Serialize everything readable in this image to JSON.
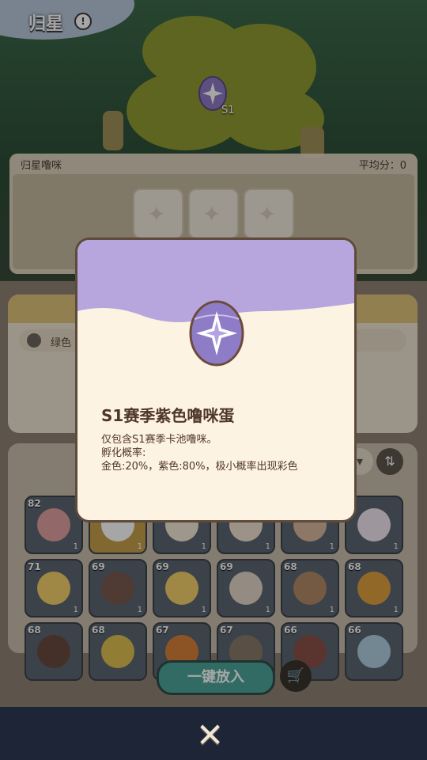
{
  "header": {
    "title": "归星"
  },
  "tree": {
    "egg_label": "S1"
  },
  "panel": {
    "name": "归星噜咪",
    "avg_score": "平均分：0"
  },
  "filter": {
    "label": "绿色"
  },
  "cards": [
    {
      "level": "82",
      "count": "1"
    },
    {
      "level": "",
      "count": "1"
    },
    {
      "level": "",
      "count": "1"
    },
    {
      "level": "",
      "count": "1"
    },
    {
      "level": "",
      "count": "1"
    },
    {
      "level": "2",
      "count": "1"
    },
    {
      "level": "71",
      "count": "1"
    },
    {
      "level": "69",
      "count": "1"
    },
    {
      "level": "69",
      "count": "1"
    },
    {
      "level": "69",
      "count": "1"
    },
    {
      "level": "68",
      "count": "1"
    },
    {
      "level": "68",
      "count": "1"
    },
    {
      "level": "68",
      "count": ""
    },
    {
      "level": "68",
      "count": ""
    },
    {
      "level": "67",
      "count": ""
    },
    {
      "level": "67",
      "count": ""
    },
    {
      "level": "66",
      "count": ""
    },
    {
      "level": "66",
      "count": ""
    }
  ],
  "actions": {
    "put_all": "一键放入"
  },
  "popup": {
    "title": "S1赛季紫色噜咪蛋",
    "line1": "仅包含S1赛季卡池噜咪。",
    "line2": "孵化概率:",
    "line3": "金色:20%，紫色:80%，极小概率出现彩色"
  },
  "colors": {
    "egg_purple": "#8f7cc7",
    "popup_bg": "#fdf3e2",
    "wave": "#b6a6dd",
    "button_teal": "#4ea39a"
  },
  "icons": {
    "close": "close-icon",
    "cart": "cart-icon",
    "info": "info-icon",
    "sort": "sort-icon"
  }
}
